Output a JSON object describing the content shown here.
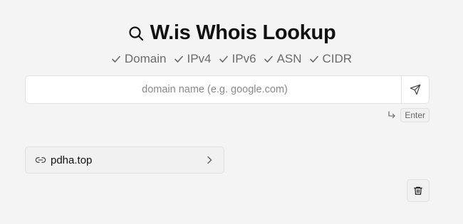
{
  "header": {
    "title": "W.is Whois Lookup",
    "icon": "search-icon"
  },
  "features": [
    {
      "label": "Domain",
      "icon": "check-icon"
    },
    {
      "label": "IPv4",
      "icon": "check-icon"
    },
    {
      "label": "IPv6",
      "icon": "check-icon"
    },
    {
      "label": "ASN",
      "icon": "check-icon"
    },
    {
      "label": "CIDR",
      "icon": "check-icon"
    }
  ],
  "search": {
    "value": "",
    "placeholder": "domain name (e.g. google.com)",
    "submit_icon": "send-icon"
  },
  "enter_hint": {
    "icon": "corner-down-right-icon",
    "key_label": "Enter"
  },
  "history": {
    "items": [
      {
        "label": "pdha.top",
        "icon": "link-icon",
        "trailing_icon": "chevron-right-icon"
      }
    ],
    "clear_icon": "trash-icon"
  },
  "colors": {
    "background": "#f4f4f4",
    "text": "#111111",
    "muted": "#6b6b6b",
    "border": "#e2e2e2"
  }
}
